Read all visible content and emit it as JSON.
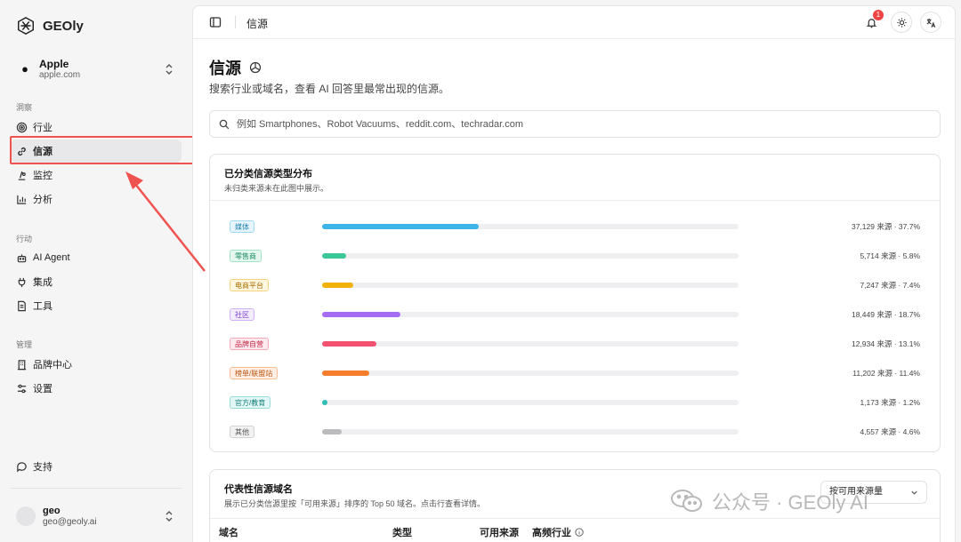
{
  "app": {
    "name": "GEOly"
  },
  "brand": {
    "name": "Apple",
    "domain": "apple.com"
  },
  "sidebar": {
    "sections": [
      {
        "label": "洞察",
        "items": [
          {
            "label": "行业",
            "icon": "radar-icon"
          },
          {
            "label": "信源",
            "icon": "link-icon",
            "active": true
          },
          {
            "label": "监控",
            "icon": "monitor-icon"
          },
          {
            "label": "分析",
            "icon": "bar-chart-icon"
          }
        ]
      },
      {
        "label": "行动",
        "items": [
          {
            "label": "AI Agent",
            "icon": "bot-icon"
          },
          {
            "label": "集成",
            "icon": "plug-icon"
          },
          {
            "label": "工具",
            "icon": "document-icon"
          }
        ]
      },
      {
        "label": "管理",
        "items": [
          {
            "label": "品牌中心",
            "icon": "building-icon"
          },
          {
            "label": "设置",
            "icon": "sliders-icon"
          }
        ]
      }
    ],
    "support": "支持",
    "user": {
      "name": "geo",
      "email": "geo@geoly.ai"
    }
  },
  "topbar": {
    "title": "信源",
    "notifications": "1"
  },
  "page": {
    "title": "信源",
    "subtitle": "搜索行业或域名，查看 AI 回答里最常出现的信源。",
    "search_placeholder": "例如 Smartphones、Robot Vacuums、reddit.com、techradar.com"
  },
  "distribution": {
    "title": "已分类信源类型分布",
    "subtitle": "未归类来源未在此图中展示。",
    "rows": [
      {
        "label": "媒体",
        "stat": "37,129 来源 · 37.7%",
        "percent": 37.7,
        "color": "#3db3e8",
        "tag_bg": "#e6f5fc",
        "tag_border": "#9ed9f3",
        "tag_color": "#1f7fae"
      },
      {
        "label": "零售商",
        "stat": "5,714 来源 · 5.8%",
        "percent": 5.8,
        "color": "#3cc79a",
        "tag_bg": "#e5f8f0",
        "tag_border": "#9fe3c9",
        "tag_color": "#1c8a62"
      },
      {
        "label": "电商平台",
        "stat": "7,247 来源 · 7.4%",
        "percent": 7.4,
        "color": "#f1b20c",
        "tag_bg": "#fef6df",
        "tag_border": "#f5d37b",
        "tag_color": "#a46f00"
      },
      {
        "label": "社区",
        "stat": "18,449 来源 · 18.7%",
        "percent": 18.7,
        "color": "#a66df2",
        "tag_bg": "#f3ebfe",
        "tag_border": "#cfb1f8",
        "tag_color": "#7a3fd0"
      },
      {
        "label": "品牌自营",
        "stat": "12,934 来源 · 13.1%",
        "percent": 13.1,
        "color": "#f2526f",
        "tag_bg": "#fdeaee",
        "tag_border": "#f6a7b6",
        "tag_color": "#c42a48"
      },
      {
        "label": "榜单/联盟站",
        "stat": "11,202 来源 · 11.4%",
        "percent": 11.4,
        "color": "#f57d2c",
        "tag_bg": "#feeee3",
        "tag_border": "#f8bd94",
        "tag_color": "#bd5512"
      },
      {
        "label": "官方/教育",
        "stat": "1,173 来源 · 1.2%",
        "percent": 1.2,
        "color": "#31bdb5",
        "tag_bg": "#e3f7f6",
        "tag_border": "#98dcd8",
        "tag_color": "#12807a"
      },
      {
        "label": "其他",
        "stat": "4,557 来源 · 4.6%",
        "percent": 4.6,
        "color": "#bbbbbd",
        "tag_bg": "#f2f2f3",
        "tag_border": "#d2d2d4",
        "tag_color": "#555555"
      }
    ]
  },
  "domains": {
    "title": "代表性信源域名",
    "subtitle": "展示已分类信源里按「可用来源」排序的 Top 50 域名。点击行查看详情。",
    "sort_value": "按可用来源量",
    "columns": [
      "域名",
      "类型",
      "可用来源",
      "高频行业"
    ]
  },
  "watermark": {
    "text": "公众号 · GEOly AI"
  }
}
